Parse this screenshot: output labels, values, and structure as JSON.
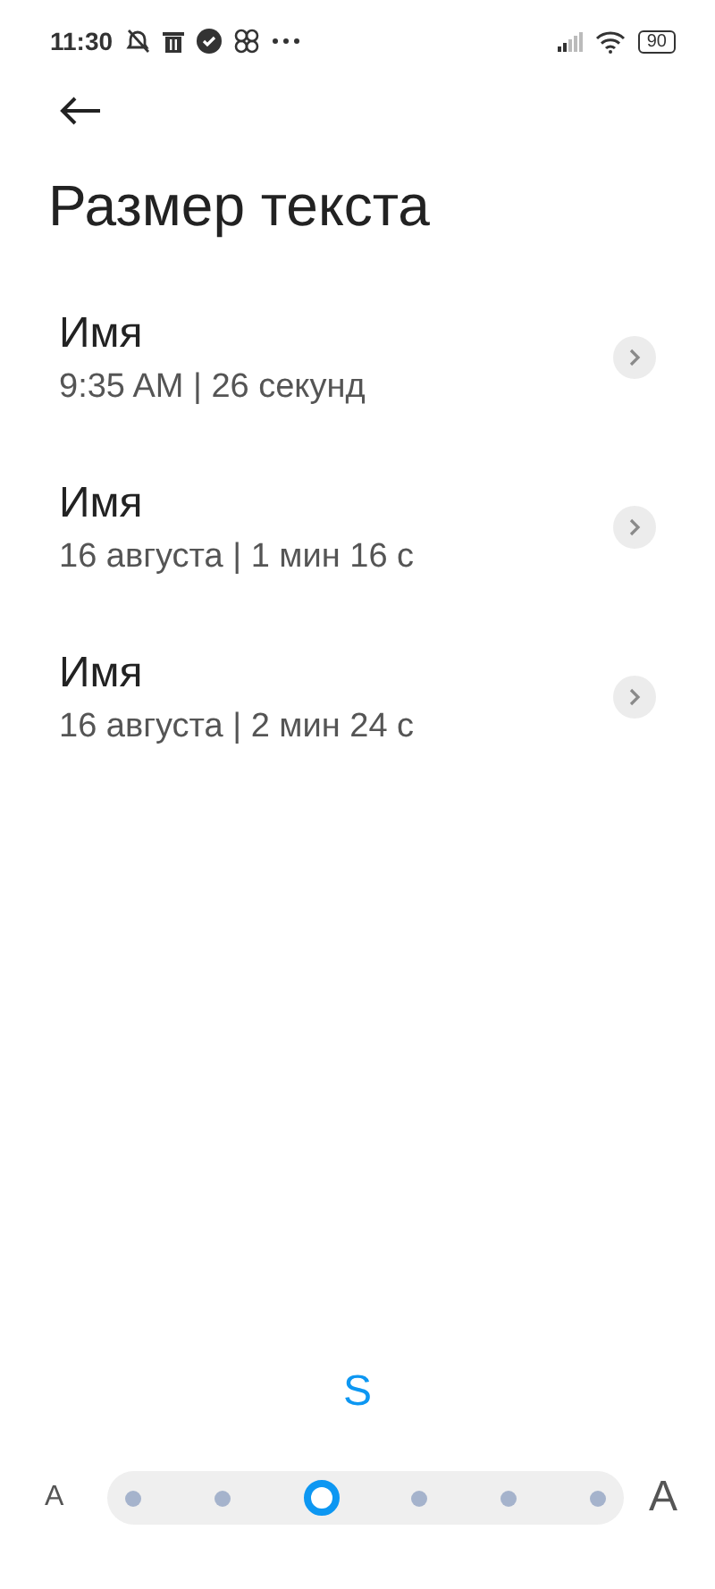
{
  "status_bar": {
    "time": "11:30",
    "battery": "90"
  },
  "title": "Размер текста",
  "items": [
    {
      "name": "Имя",
      "detail": "9:35 AM | 26 секунд"
    },
    {
      "name": "Имя",
      "detail": "16 августа | 1 мин 16 с"
    },
    {
      "name": "Имя",
      "detail": "16 августа | 2 мин 24 с"
    }
  ],
  "size_label": "S",
  "slider": {
    "small_label": "A",
    "large_label": "A",
    "stops": [
      {
        "selected": false
      },
      {
        "selected": false
      },
      {
        "selected": true
      },
      {
        "selected": false
      },
      {
        "selected": false
      },
      {
        "selected": false
      }
    ]
  }
}
